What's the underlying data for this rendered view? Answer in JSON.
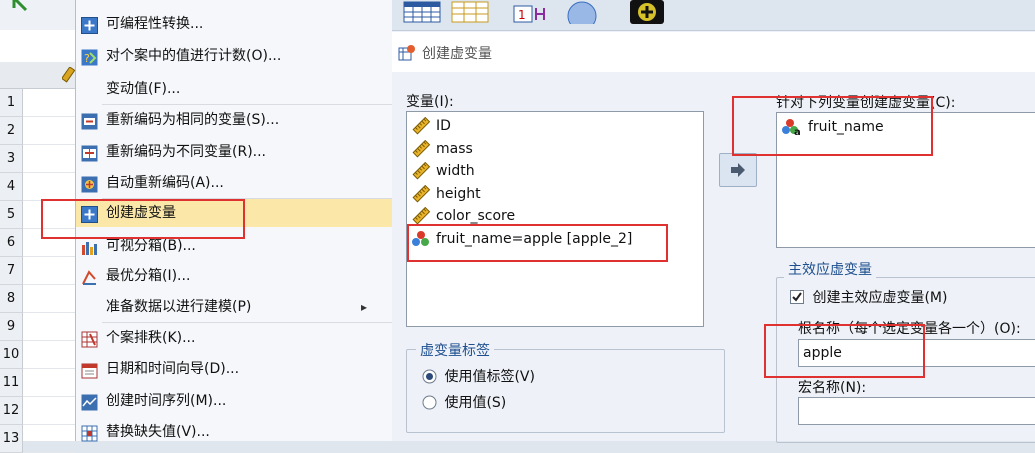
{
  "rows": [
    "1",
    "2",
    "3",
    "4",
    "5",
    "6",
    "7",
    "8",
    "9",
    "10",
    "11",
    "12",
    "13"
  ],
  "menu": {
    "items": [
      {
        "label": "可编程性转换...",
        "icon": "plus-box-icon"
      },
      {
        "label": "对个案中的值进行计数(O)...",
        "icon": "count-icon"
      },
      {
        "label": "变动值(F)...",
        "icon": ""
      },
      {
        "label": "重新编码为相同的变量(S)...",
        "icon": "recode-same-icon"
      },
      {
        "label": "重新编码为不同变量(R)...",
        "icon": "recode-different-icon"
      },
      {
        "label": "自动重新编码(A)...",
        "icon": "auto-recode-icon"
      },
      {
        "label": "创建虚变量",
        "icon": "plus-box-icon"
      },
      {
        "label": "可视分箱(B)...",
        "icon": "visual-binning-icon"
      },
      {
        "label": "最优分箱(I)...",
        "icon": "optimal-binning-icon"
      },
      {
        "label": "准备数据以进行建模(P)",
        "icon": ""
      },
      {
        "label": "个案排秩(K)...",
        "icon": "rank-icon"
      },
      {
        "label": "日期和时间向导(D)...",
        "icon": "calendar-icon"
      },
      {
        "label": "创建时间序列(M)...",
        "icon": "time-series-icon"
      },
      {
        "label": "替换缺失值(V)...",
        "icon": "replace-missing-icon"
      }
    ],
    "submenu_arrow": "▸"
  },
  "dialog": {
    "title": "创建虚变量",
    "variables_label": "变量(I):",
    "variables": [
      {
        "name": "ID",
        "icon": "ruler-icon"
      },
      {
        "name": "mass",
        "icon": "ruler-icon"
      },
      {
        "name": "width",
        "icon": "ruler-icon"
      },
      {
        "name": "height",
        "icon": "ruler-icon"
      },
      {
        "name": "color_score",
        "icon": "ruler-icon"
      },
      {
        "name": "fruit_name=apple [apple_2]",
        "icon": "nominal-icon"
      }
    ],
    "target_label": "针对下列变量创建虚变量(C):",
    "target_vars": [
      {
        "name": "fruit_name",
        "icon": "nominal-string-icon"
      }
    ],
    "dummy_label_group": "虚变量标签",
    "radio_use_value_labels": "使用值标签(V)",
    "radio_use_values": "使用值(S)",
    "main_effect_group": "主效应虚变量",
    "checkbox_create_main": "创建主效应虚变量(M)",
    "root_name_label": "根名称（每个选定变量各一个）(O):",
    "root_name_value": "apple",
    "macro_name_label": "宏名称(N):",
    "macro_name_value": ""
  }
}
